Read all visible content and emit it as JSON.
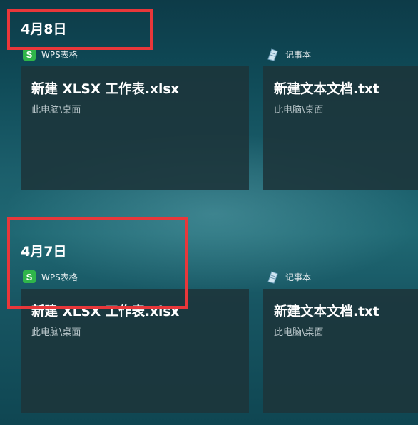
{
  "groups": [
    {
      "date": "4月8日",
      "items": [
        {
          "app_name": "WPS表格",
          "app_icon": "wps-spreadsheet-icon",
          "title": "新建 XLSX 工作表.xlsx",
          "path": "此电脑\\桌面"
        },
        {
          "app_name": "记事本",
          "app_icon": "notepad-icon",
          "title": "新建文本文档.txt",
          "path": "此电脑\\桌面"
        }
      ]
    },
    {
      "date": "4月7日",
      "items": [
        {
          "app_name": "WPS表格",
          "app_icon": "wps-spreadsheet-icon",
          "title": "新建 XLSX 工作表.xlsx",
          "path": "此电脑\\桌面"
        },
        {
          "app_name": "记事本",
          "app_icon": "notepad-icon",
          "title": "新建文本文档.txt",
          "path": "此电脑\\桌面"
        }
      ]
    }
  ],
  "colors": {
    "highlight": "#e8373a",
    "wps_green": "#2fb54a",
    "card_bg": "#1c343a"
  }
}
